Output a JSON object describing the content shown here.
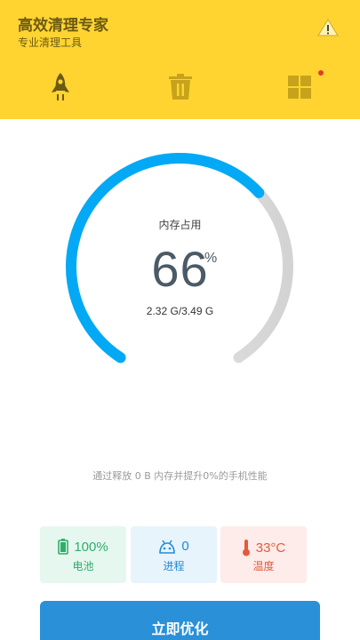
{
  "header": {
    "title": "高效清理专家",
    "subtitle": "专业清理工具",
    "tabs": [
      {
        "name": "boost",
        "icon": "rocket-icon"
      },
      {
        "name": "clean",
        "icon": "trash-icon"
      },
      {
        "name": "apps",
        "icon": "grid-icon",
        "has_badge": true
      }
    ]
  },
  "memory": {
    "label": "内存占用",
    "percent": "66",
    "unit": "%",
    "detail": "2.32 G/3.49 G",
    "fraction": 0.66
  },
  "hint": "通过释放 0 B 内存并提升0%的手机性能",
  "stats": {
    "battery": {
      "value": "100%",
      "label": "电池",
      "icon": "battery-icon"
    },
    "process": {
      "value": "0",
      "label": "进程",
      "icon": "android-icon"
    },
    "temperature": {
      "value": "33°C",
      "label": "温度",
      "icon": "thermometer-icon"
    }
  },
  "action": {
    "label": "立即优化"
  },
  "colors": {
    "header_bg": "#FFD431",
    "accent_blue": "#03A9F4",
    "button_blue": "#2A90D8",
    "track_gray": "#D6D6D6"
  }
}
